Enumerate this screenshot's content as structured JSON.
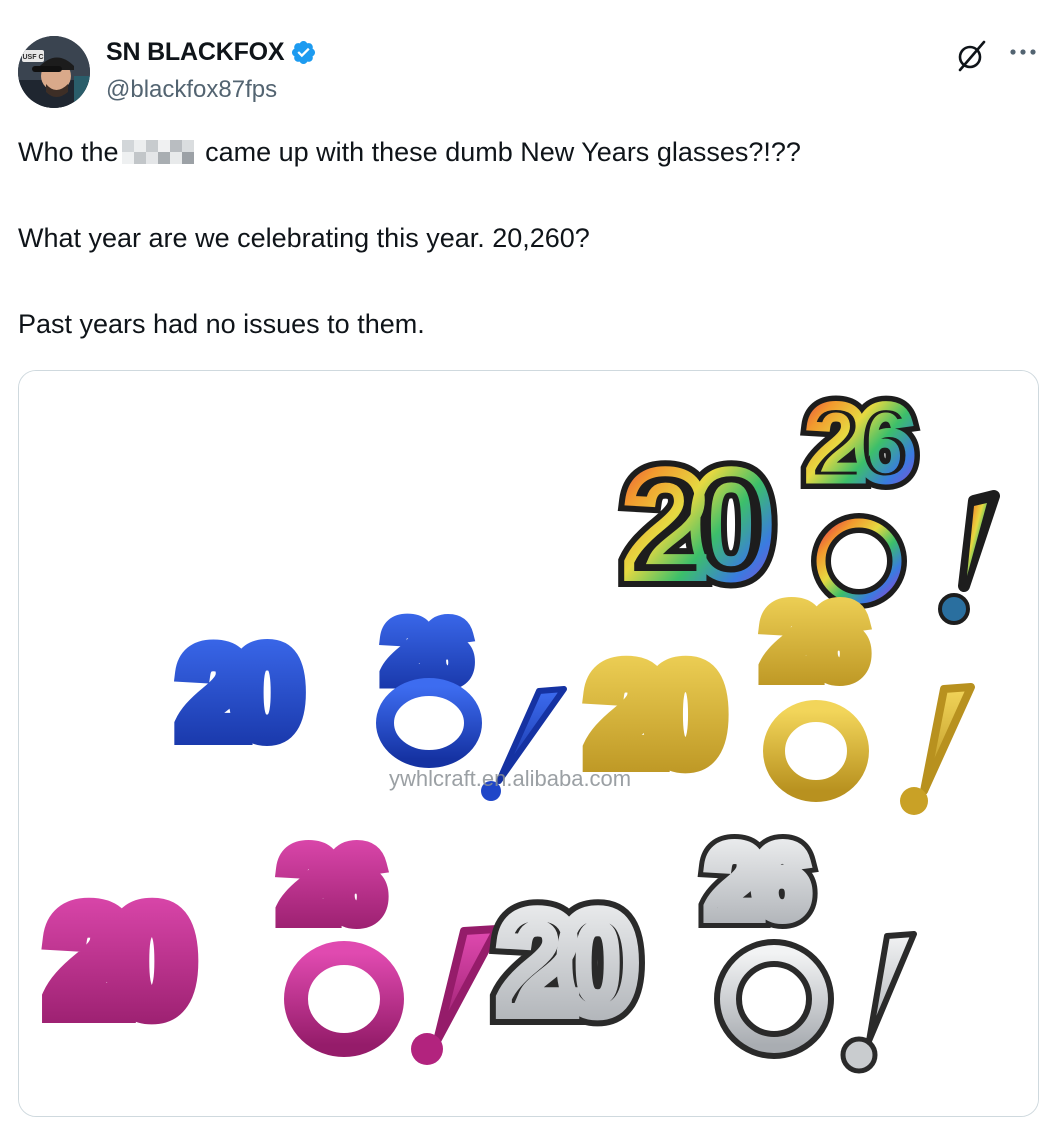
{
  "author": {
    "display_name": "SN BLACKFOX",
    "handle": "@blackfox87fps",
    "verified": true,
    "avatar_icon": "user-avatar-with-cap",
    "avatar_cap_text": "USF C"
  },
  "actions": {
    "grok_icon": "grok-icon",
    "more_icon": "more-horizontal-icon"
  },
  "tweet": {
    "line1_before": "Who the",
    "line1_censored": "censored-word",
    "line1_after": " came up with these dumb New Years glasses?!??",
    "line2": "What year are we celebrating this year. 20,260?",
    "line3": "Past years had no issues to them."
  },
  "media": {
    "description_icon": "novelty-glasses-photo",
    "glasses_text": "2026!",
    "glasses_top_number": "26",
    "glasses_bottom_number": "20",
    "watermark": "ywhlcraft.en.alibaba.com",
    "colors": {
      "blue": "#1f46c8",
      "gold": "#d9b634",
      "pink": "#c1298a",
      "silver": "#c9cccf",
      "rainbow_outline": "#1d1d1d"
    }
  },
  "colors": {
    "text": "#0f1419",
    "secondary": "#536471",
    "verified_blue": "#1d9bf0",
    "border": "#cfd9de"
  }
}
